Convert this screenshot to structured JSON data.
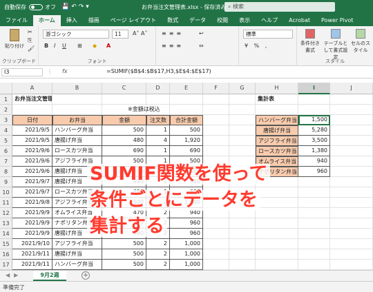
{
  "titlebar": {
    "autosave": "自動保存",
    "autosave_state": "オフ",
    "filename": "お弁当注文管理表.xlsx - 保存済み",
    "search": "検索"
  },
  "tabs": [
    "ファイル",
    "ホーム",
    "挿入",
    "描画",
    "ページ レイアウト",
    "数式",
    "データ",
    "校閲",
    "表示",
    "ヘルプ",
    "Acrobat",
    "Power Pivot"
  ],
  "ribbon": {
    "paste": "貼り付け",
    "clipboard": "クリップボード",
    "font_name": "游ゴシック",
    "font_size": "11",
    "font": "フォント",
    "number_format": "標準",
    "cond_format": "条件付き書式",
    "table_format": "テーブルとして書式設定",
    "cell_style": "セルのスタイル",
    "style": "スタイル"
  },
  "formula_bar": {
    "name_box": "I3",
    "fx": "fx",
    "formula": "=SUMIF($B$4:$B$17,H3,$E$4:$E$17)"
  },
  "columns": [
    "A",
    "B",
    "C",
    "D",
    "E",
    "F",
    "G",
    "H",
    "I",
    "J"
  ],
  "sheet": {
    "title": "お弁当注文管理表",
    "note": "※金額は税込",
    "headers": [
      "日付",
      "お弁当",
      "金額",
      "注文数",
      "合計金額"
    ],
    "rows": [
      [
        "2021/9/5",
        "ハンバーグ弁当",
        "500",
        "1",
        "500"
      ],
      [
        "2021/9/5",
        "唐揚げ弁当",
        "480",
        "4",
        "1,920"
      ],
      [
        "2021/9/6",
        "ロースカツ弁当",
        "690",
        "1",
        "690"
      ],
      [
        "2021/9/6",
        "アジフライ弁当",
        "500",
        "1",
        "500"
      ],
      [
        "2021/9/6",
        "唐揚げ弁当",
        "480",
        "1",
        "480"
      ],
      [
        "2021/9/7",
        "唐揚げ弁当",
        "480",
        "2",
        "960"
      ],
      [
        "2021/9/7",
        "ロースカツ弁当",
        "690",
        "1",
        "690"
      ],
      [
        "2021/9/8",
        "アジフライ弁当",
        "500",
        "2",
        "1,000"
      ],
      [
        "2021/9/9",
        "オムライス弁当",
        "470",
        "2",
        "940"
      ],
      [
        "2021/9/9",
        "ナポリタン弁当",
        "480",
        "2",
        "960"
      ],
      [
        "2021/9/9",
        "唐揚げ弁当",
        "480",
        "2",
        "960"
      ],
      [
        "2021/9/10",
        "アジフライ弁当",
        "500",
        "2",
        "1,000"
      ],
      [
        "2021/9/11",
        "唐揚げ弁当",
        "500",
        "2",
        "1,000"
      ],
      [
        "2021/9/11",
        "ハンバーグ弁当",
        "500",
        "2",
        "1,000"
      ]
    ],
    "summary_title": "集計表",
    "summary": [
      [
        "ハンバーグ弁当",
        "1,500"
      ],
      [
        "唐揚げ弁当",
        "5,280"
      ],
      [
        "アジフライ弁当",
        "3,500"
      ],
      [
        "ロースカツ弁当",
        "1,380"
      ],
      [
        "オムライス弁当",
        "940"
      ],
      [
        "ナポリタン弁当",
        "960"
      ]
    ]
  },
  "overlay": [
    "SUMIF関数を使って",
    "条件ごとにデータを",
    "集計する"
  ],
  "sheet_tab": "9月2週",
  "status": "準備完了",
  "colors": {
    "excel_green": "#217346",
    "header_fill": "#f8cbad",
    "overlay_text": "#ff3b2f"
  }
}
